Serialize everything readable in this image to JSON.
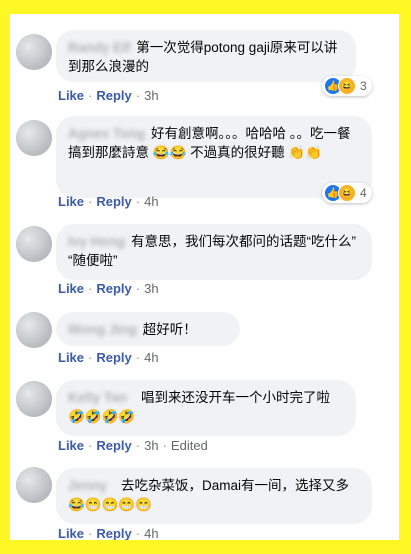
{
  "comments": [
    {
      "name": "Randy Elf",
      "text": "第一次觉得potong gaji原来可以讲到那么浪漫的",
      "like": "Like",
      "reply": "Reply",
      "time": "3h",
      "reaction_count": "3"
    },
    {
      "name": "Agnes Tong",
      "text": "好有創意啊。。。哈哈哈 。。吃一餐搞到那麼詩意 😂😂 不過真的很好聽 👏👏",
      "like": "Like",
      "reply": "Reply",
      "time": "4h",
      "reaction_count": "4"
    },
    {
      "name": "Ivy Hong",
      "text": "有意思，我们每次都问的话题“吃什么” “随便啦”",
      "like": "Like",
      "reply": "Reply",
      "time": "3h"
    },
    {
      "name": "Wong Jing",
      "text": "超好听！",
      "like": "Like",
      "reply": "Reply",
      "time": "4h"
    },
    {
      "name": "Kelly Tan",
      "text": "唱到来还没开车一个小时完了啦🤣🤣🤣🤣",
      "like": "Like",
      "reply": "Reply",
      "time": "3h",
      "edited": "Edited"
    },
    {
      "name": "Jenny",
      "text": "去吃杂菜饭，Damai有一间，选择又多😂😁😁😁😁",
      "like": "Like",
      "reply": "Reply",
      "time": "4h"
    }
  ]
}
